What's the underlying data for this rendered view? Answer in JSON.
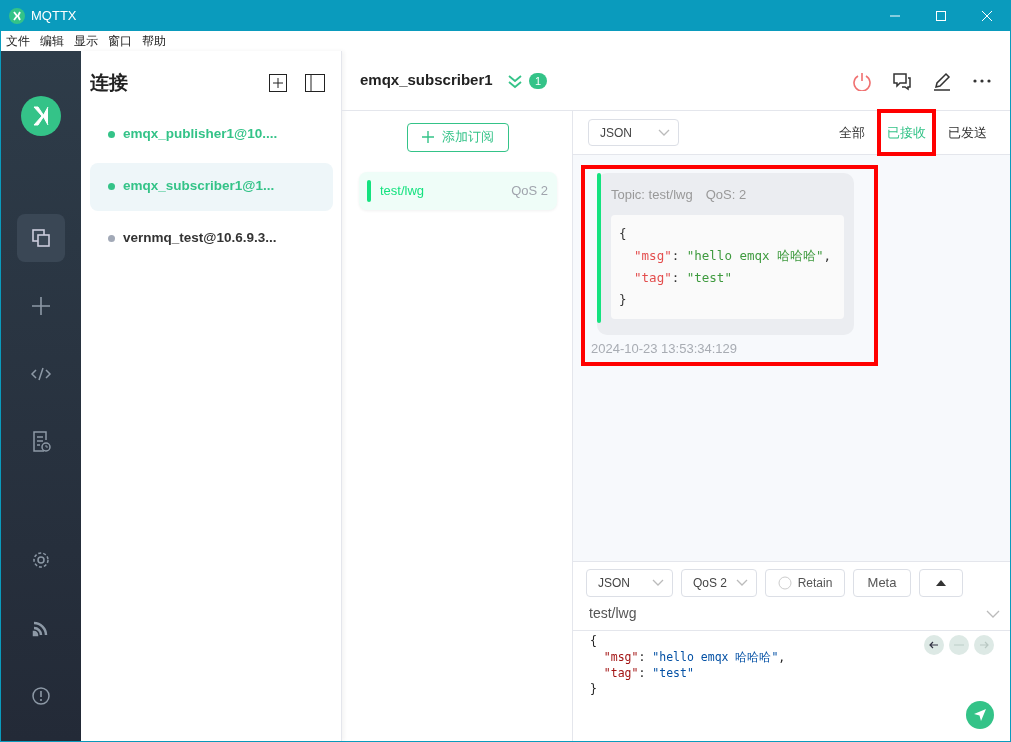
{
  "window": {
    "title": "MQTTX"
  },
  "menu": [
    "文件",
    "编辑",
    "显示",
    "窗口",
    "帮助"
  ],
  "sidebar": {
    "items": [
      {
        "kind": "connections",
        "selected": true
      },
      {
        "kind": "new",
        "selected": false
      },
      {
        "kind": "script",
        "selected": false
      },
      {
        "kind": "log",
        "selected": false
      },
      {
        "kind": "settings",
        "selected": false
      },
      {
        "kind": "feed",
        "selected": false
      },
      {
        "kind": "about",
        "selected": false
      }
    ]
  },
  "connections": {
    "title": "连接",
    "items": [
      {
        "name": "emqx_publisher1@10....",
        "connected": true,
        "selected": false
      },
      {
        "name": "emqx_subscriber1@1...",
        "connected": true,
        "selected": true
      },
      {
        "name": "vernmq_test@10.6.9.3...",
        "connected": false,
        "selected": false
      }
    ]
  },
  "header": {
    "name": "emqx_subscriber1",
    "unread": "1"
  },
  "subscriptions": {
    "add_label": "添加订阅",
    "items": [
      {
        "topic": "test/lwg",
        "qos": "QoS 2",
        "color": "#14e27f",
        "selected": true
      }
    ]
  },
  "messages": {
    "format": "JSON",
    "filters": [
      {
        "label": "全部",
        "selected": false,
        "highlighted": false
      },
      {
        "label": "已接收",
        "selected": true,
        "highlighted": true
      },
      {
        "label": "已发送",
        "selected": false,
        "highlighted": false
      }
    ],
    "items": [
      {
        "topic": "Topic: test/lwg",
        "qos": "QoS: 2",
        "highlighted": true,
        "time": "2024-10-23 13:53:34:129",
        "payload": [
          [
            {
              "kind": "punct",
              "text": "{"
            }
          ],
          [
            {
              "kind": "key",
              "text": "  \"msg\""
            },
            {
              "kind": "punct",
              "text": ": "
            },
            {
              "kind": "string",
              "text": "\"hello emqx 哈哈哈\""
            },
            {
              "kind": "punct",
              "text": ","
            }
          ],
          [
            {
              "kind": "key",
              "text": "  \"tag\""
            },
            {
              "kind": "punct",
              "text": ": "
            },
            {
              "kind": "string",
              "text": "\"test\""
            }
          ],
          [
            {
              "kind": "punct",
              "text": "}"
            }
          ]
        ]
      }
    ]
  },
  "publisher": {
    "format": "JSON",
    "qos": "QoS 2",
    "retain": {
      "label": "Retain",
      "checked": false
    },
    "meta_label": "Meta",
    "topic": "test/lwg",
    "payload": [
      [
        {
          "kind": "punct",
          "text": "{"
        }
      ],
      [
        {
          "kind": "key",
          "text": "  \"msg\""
        },
        {
          "kind": "punct",
          "text": ": "
        },
        {
          "kind": "string",
          "text": "\"hello emqx 哈哈哈\""
        },
        {
          "kind": "punct",
          "text": ","
        }
      ],
      [
        {
          "kind": "key",
          "text": "  \"tag\""
        },
        {
          "kind": "punct",
          "text": ": "
        },
        {
          "kind": "string",
          "text": "\"test\""
        }
      ],
      [
        {
          "kind": "punct",
          "text": "}"
        }
      ]
    ]
  }
}
